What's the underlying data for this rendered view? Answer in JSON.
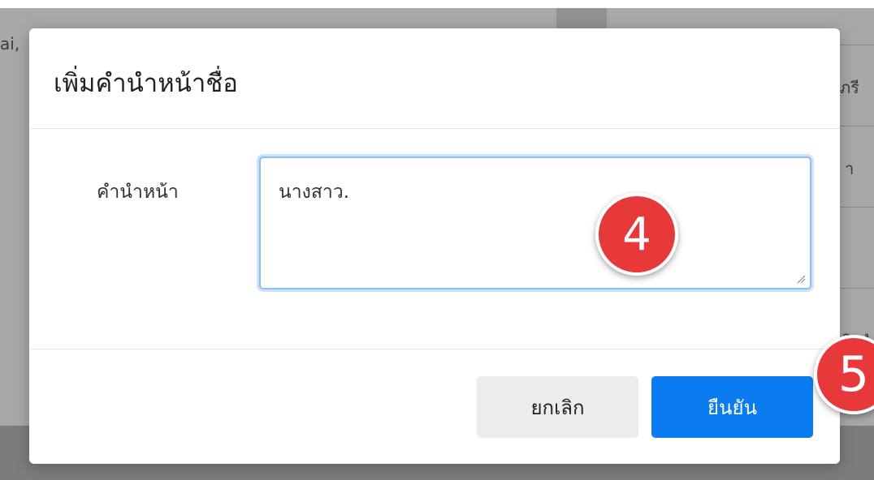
{
  "background": {
    "text_left": "ai,",
    "text_right_1": "ภรี",
    "text_right_2": "า",
    "text_right_3": "อ. ง"
  },
  "modal": {
    "title": "เพิ่มคำนำหน้าชื่อ",
    "field_label": "คำนำหน้า",
    "field_value": "นางสาว.",
    "cancel_label": "ยกเลิก",
    "confirm_label": "ยืนยัน"
  },
  "annotations": {
    "step_4": "4",
    "step_5": "5",
    "badge_color": "#e8393a"
  },
  "colors": {
    "confirm_button": "#0a7cf0",
    "cancel_button": "#ececec",
    "focus_border": "#8fbef3"
  }
}
